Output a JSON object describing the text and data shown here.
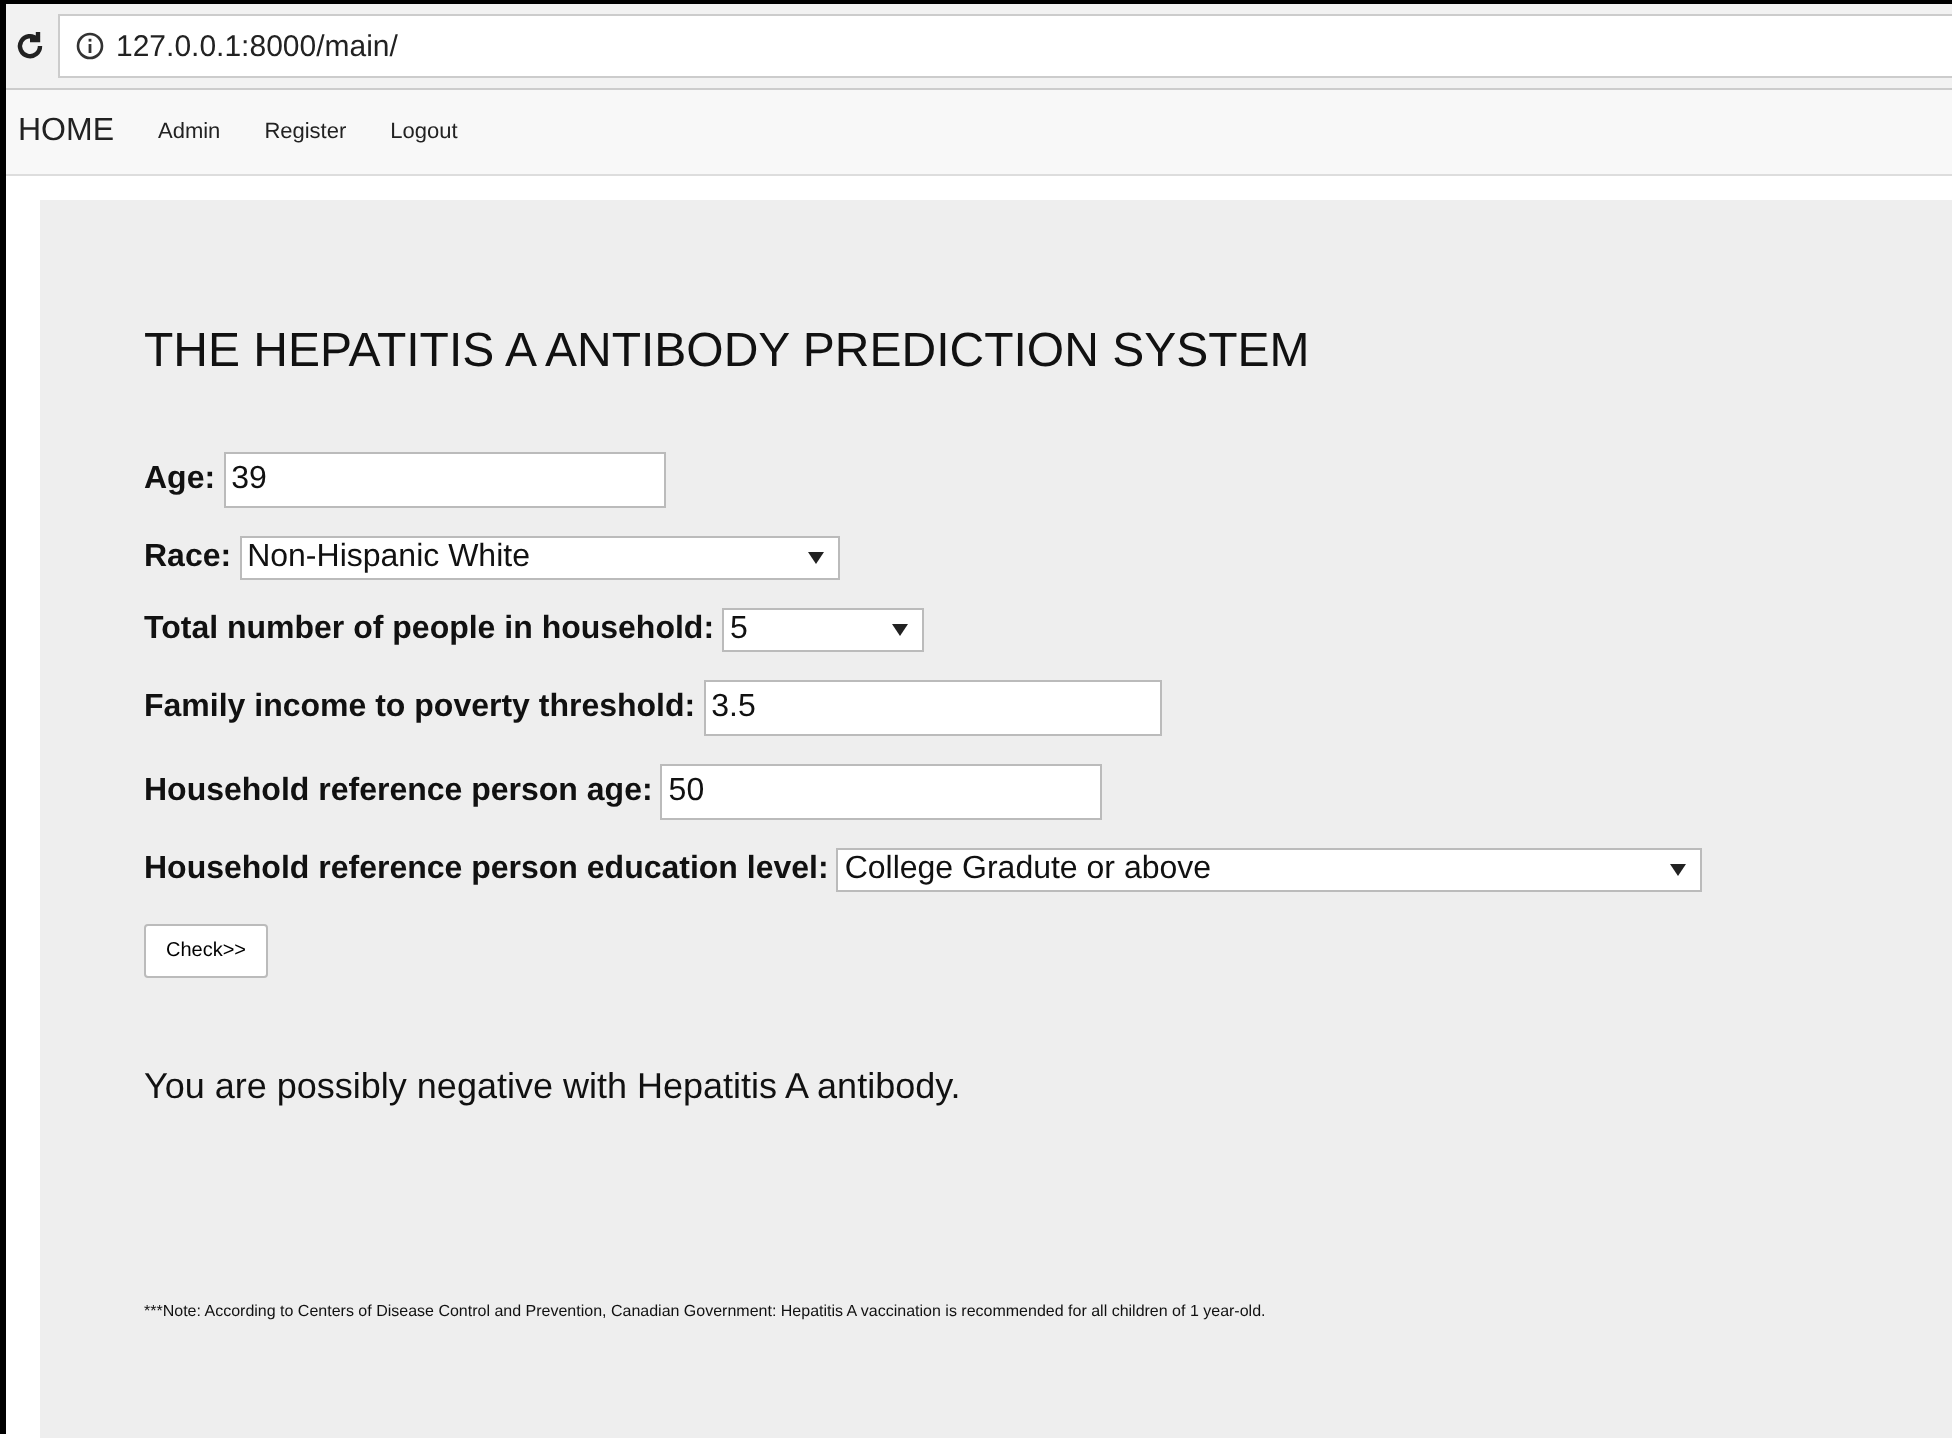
{
  "browser": {
    "url": "127.0.0.1:8000/main/"
  },
  "nav": [
    {
      "label": "HOME",
      "kind": "brand"
    },
    {
      "label": "Admin",
      "kind": "link"
    },
    {
      "label": "Register",
      "kind": "link"
    },
    {
      "label": "Logout",
      "kind": "link"
    }
  ],
  "form": {
    "title": "THE HEPATITIS A ANTIBODY PREDICTION SYSTEM",
    "fields": [
      {
        "label": "Age:",
        "kind": "text",
        "value": "39"
      },
      {
        "label": "Race:",
        "kind": "select",
        "value": "Non-Hispanic White"
      },
      {
        "label": "Total number of people in household:",
        "kind": "select",
        "value": "5"
      },
      {
        "label": "Family income to poverty threshold:",
        "kind": "text",
        "value": "3.5"
      },
      {
        "label": "Household reference person age:",
        "kind": "text",
        "value": "50"
      },
      {
        "label": "Household reference person education level:",
        "kind": "select",
        "value": "College Gradute or above"
      }
    ],
    "button": "Check>>",
    "result": "You are possibly negative with Hepatitis A antibody.",
    "note": "***Note: According to Centers of Disease Control and Prevention, Canadian Government: Hepatitis A vaccination is recommended for all children of 1 year-old."
  }
}
